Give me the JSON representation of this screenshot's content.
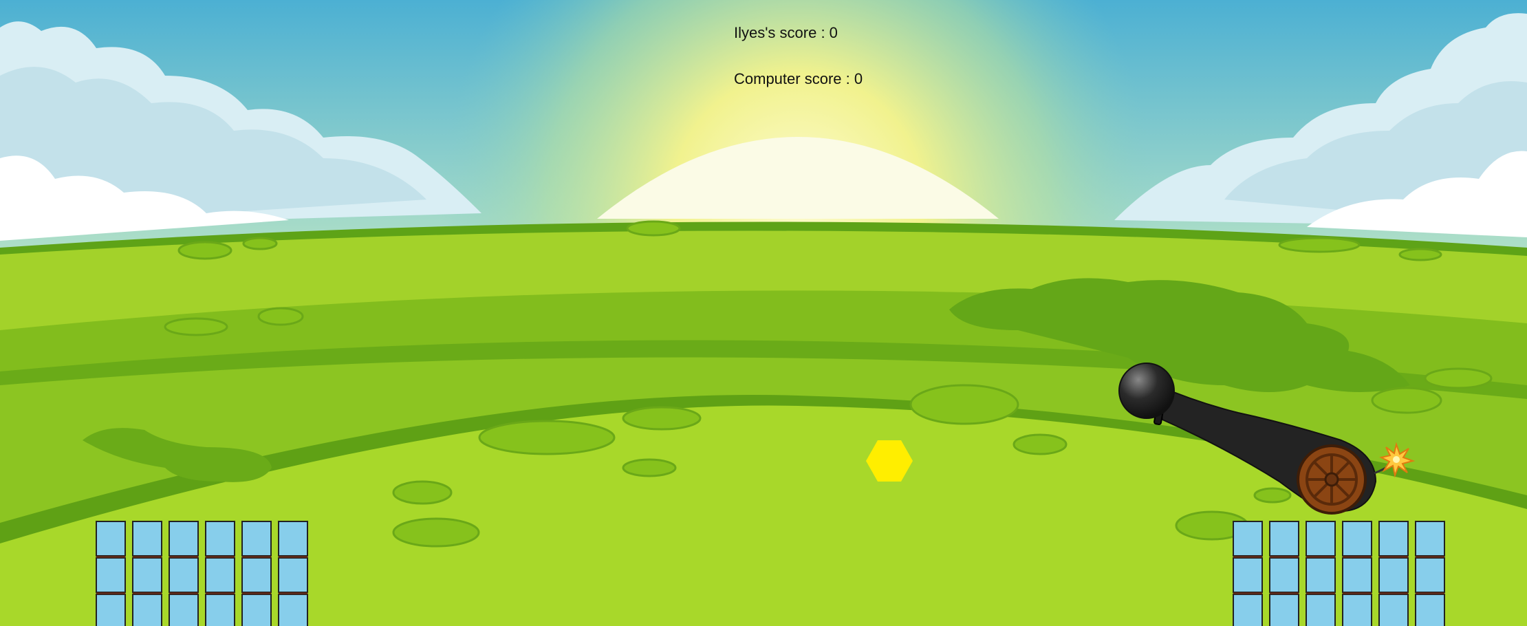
{
  "scoreboard": {
    "player_score": "Ilyes's score : 0",
    "computer_score": "Computer score : 0"
  },
  "colors": {
    "sky_top": "#4cb2d4",
    "sky_glow": "#f7f3a0",
    "grass_light": "#a9d629",
    "grass_mid": "#86c21c",
    "grass_dark": "#64a718",
    "block_fill": "#87ceeb",
    "block_border": "#5a2a1a",
    "cannon_body": "#232323",
    "wheel": "#8b4513",
    "hexagon": "#ffee00"
  },
  "objects": {
    "cannon": "cannon-icon",
    "cannonball": "cannonball-icon",
    "fuse_spark": "spark-icon",
    "target": "hexagon-target",
    "left_tower": "block-tower",
    "right_tower": "block-tower"
  }
}
